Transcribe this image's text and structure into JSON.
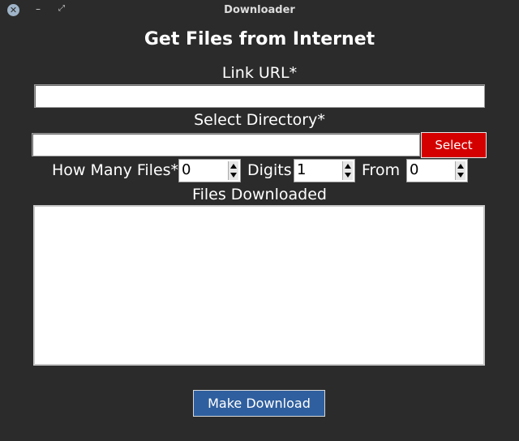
{
  "window": {
    "title": "Downloader",
    "close_glyph": "✕",
    "minimize_glyph": "–",
    "maximize_glyph": "⤢"
  },
  "form": {
    "heading": "Get Files from Internet",
    "url_label": "Link URL*",
    "url_value": "",
    "directory_label": "Select Directory*",
    "directory_value": "",
    "select_button": "Select",
    "how_many_label": "How Many Files*",
    "how_many_value": "0",
    "digits_label": "Digits",
    "digits_value": "1",
    "from_label": "From",
    "from_value": "0",
    "downloaded_label": "Files Downloaded",
    "downloaded_text": "",
    "download_button": "Make Download"
  },
  "colors": {
    "background": "#2b2b2b",
    "select_button": "#d40000",
    "download_button": "#2f5f9e"
  }
}
